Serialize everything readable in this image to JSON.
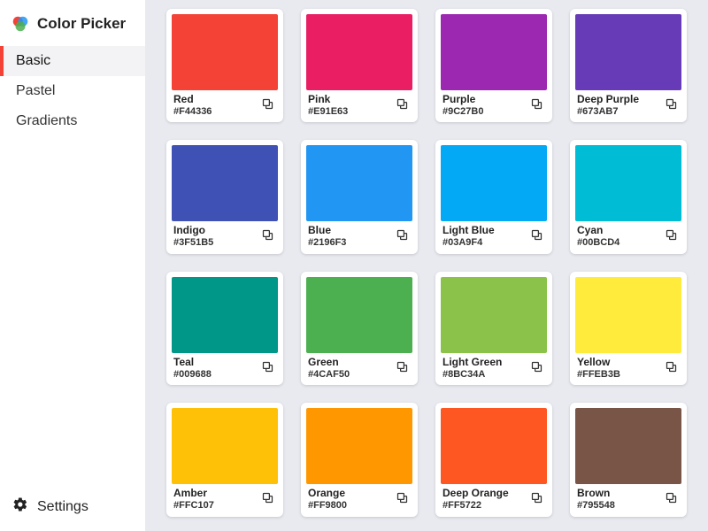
{
  "brand": {
    "title": "Color Picker"
  },
  "sidebar": {
    "items": [
      {
        "label": "Basic",
        "active": true
      },
      {
        "label": "Pastel",
        "active": false
      },
      {
        "label": "Gradients",
        "active": false
      }
    ],
    "settings_label": "Settings"
  },
  "swatches": [
    {
      "name": "Red",
      "hex": "#F44336"
    },
    {
      "name": "Pink",
      "hex": "#E91E63"
    },
    {
      "name": "Purple",
      "hex": "#9C27B0"
    },
    {
      "name": "Deep Purple",
      "hex": "#673AB7"
    },
    {
      "name": "Indigo",
      "hex": "#3F51B5"
    },
    {
      "name": "Blue",
      "hex": "#2196F3"
    },
    {
      "name": "Light Blue",
      "hex": "#03A9F4"
    },
    {
      "name": "Cyan",
      "hex": "#00BCD4"
    },
    {
      "name": "Teal",
      "hex": "#009688"
    },
    {
      "name": "Green",
      "hex": "#4CAF50"
    },
    {
      "name": "Light Green",
      "hex": "#8BC34A"
    },
    {
      "name": "Yellow",
      "hex": "#FFEB3B"
    },
    {
      "name": "Amber",
      "hex": "#FFC107"
    },
    {
      "name": "Orange",
      "hex": "#FF9800"
    },
    {
      "name": "Deep Orange",
      "hex": "#FF5722"
    },
    {
      "name": "Brown",
      "hex": "#795548"
    }
  ]
}
